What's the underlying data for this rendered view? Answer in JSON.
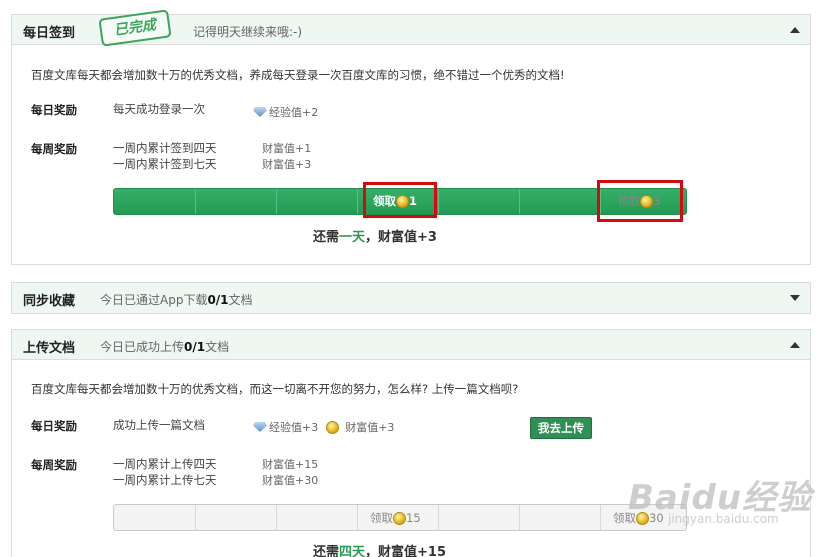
{
  "daily_sign": {
    "title": "每日签到",
    "stamp": "已完成",
    "subtitle": "记得明天继续来哦:-)",
    "intro": "百度文库每天都会增加数十万的优秀文档，养成每天登录一次百度文库的习惯，绝不错过一个优秀的文档!",
    "daily_label": "每日奖励",
    "daily_text": "每天成功登录一次",
    "daily_reward": "经验值+2",
    "weekly_label": "每周奖励",
    "weekly_lines": [
      "一周内累计签到四天",
      "一周内累计签到七天"
    ],
    "weekly_rewards": [
      "财富值+1",
      "财富值+3"
    ],
    "claim1_label": "领取",
    "claim1_value": "1",
    "claim2_label": "领取",
    "claim2_value": "3",
    "need_prefix": "还需",
    "need_days": "一天",
    "need_suffix": "，财富值+3"
  },
  "sync": {
    "title": "同步收藏",
    "subtitle_prefix": "今日已通过App下载",
    "subtitle_count": "0/1",
    "subtitle_suffix": "文档"
  },
  "upload": {
    "title": "上传文档",
    "subtitle_prefix": "今日已成功上传",
    "subtitle_count": "0/1",
    "subtitle_suffix": "文档",
    "intro": "百度文库每天都会增加数十万的优秀文档，而这一切离不开您的努力，怎么样? 上传一篇文档呗?",
    "daily_label": "每日奖励",
    "daily_text": "成功上传一篇文档",
    "daily_reward_exp": "经验值+3",
    "daily_reward_wealth": "财富值+3",
    "button": "我去上传",
    "weekly_label": "每周奖励",
    "weekly_lines": [
      "一周内累计上传四天",
      "一周内累计上传七天"
    ],
    "weekly_rewards": [
      "财富值+15",
      "财富值+30"
    ],
    "claim1_label": "领取",
    "claim1_value": "15",
    "claim2_label": "领取",
    "claim2_value": "30",
    "need_prefix": "还需",
    "need_days": "四天",
    "need_suffix": "，财富值+15"
  },
  "watermark": {
    "main": "Baidu经验",
    "sub": "jingyan.baidu.com"
  },
  "colors": {
    "accent_green": "#2a9a52",
    "header_bg": "#eef7f1",
    "highlight_red": "#d60a0a"
  }
}
